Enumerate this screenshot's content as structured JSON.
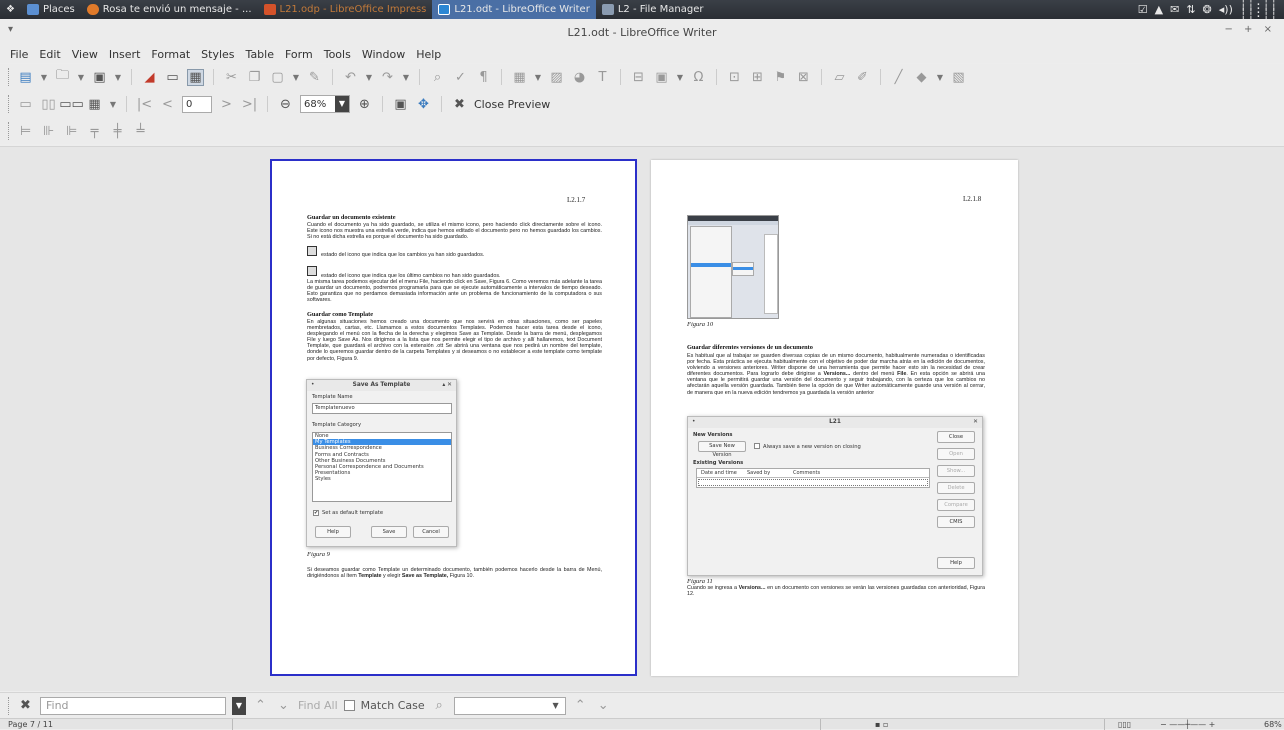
{
  "panel": {
    "places": "Places",
    "tasks": [
      {
        "label": "Rosa te envió un mensaje - ...",
        "style": "normal",
        "icon_color": "#e07a2a"
      },
      {
        "label": "L21.odp - LibreOffice Impress",
        "style": "dim",
        "icon_color": "#d4522a"
      },
      {
        "label": "L21.odt - LibreOffice Writer",
        "style": "active",
        "icon_color": "#2a86d4"
      },
      {
        "label": "L2 - File Manager",
        "style": "normal",
        "icon_color": "#8a9bb0"
      }
    ],
    "tray_icons": [
      "☑",
      "▲",
      "✉",
      "⇅",
      "❂",
      "◂))"
    ]
  },
  "window": {
    "title": "L21.odt - LibreOffice Writer",
    "left_glyph": "▾",
    "right_glyphs": "− + ×"
  },
  "menu": [
    "File",
    "Edit",
    "View",
    "Insert",
    "Format",
    "Styles",
    "Table",
    "Form",
    "Tools",
    "Window",
    "Help"
  ],
  "preview_toolbar": {
    "page_value": "0",
    "zoom_value": "68%",
    "close_preview": "Close Preview"
  },
  "page1": {
    "number": "L2.1.7",
    "heading1": "Guardar un documento existente",
    "para1": "Cuando el documento ya ha sido guardado, se utiliza el mismo icono, pero haciendo click directamente sobre el icono. Este icono nos muestra una estrella verde, indica que hemos editado el documento pero no hemos guardado los cambios. Si no está dicha estrella es porque el documento ha sido guardado.",
    "icon_line1": "estado del icono que indica que los cambios ya han sido guardados.",
    "icon_line2": "estado del icono que indica que los último cambios no han sido guardados.",
    "para2": "La misma tarea podemos ejecutar del el menu File, haciendo click en Save, Figura 6. Como veremos más adelante la tarea de guardar un documento, podremos programarla para que se ejecute automáticamente a intervalos de tiempo deseado. Esto garantiza que no perdamos demasiada información ante un problema de funcionamiento de la computadora o sus softwares.",
    "heading2": "Guardar como Template",
    "para3": "En algunas situaciones hemos creado una documento que nos servirá en otras situaciones, como ser papeles membretados, cartas, etc. Llamamos a estos documentos Templates. Podemos hacer esta tarea desde el icono, desplegando el menú con la flecha de la derecha y elegimos Save as Template. Desde la barra de menú, desplegamos File y luego Save As. Nos dirigimos a la lista que nos permite elegir el tipo de archivo y allí hallaremos, text Document Template, que guardará el archivo con la extensión .ott Se abrirá una ventana que nos pedirá un nombre del template, donde lo queremos guardar dentro de la carpeta Templates y si deseamos o no establecer a este template como template por defecto, Figura 9.",
    "dialog": {
      "title": "Save As Template",
      "name_label": "Template Name",
      "name_value": "Templatenuevo",
      "category_label": "Template Category",
      "categories": [
        "None",
        "My Templates",
        "Business Correspondence",
        "Forms and Contracts",
        "Other Business Documents",
        "Personal Correspondence and Documents",
        "Presentations",
        "Styles"
      ],
      "selected_index": 1,
      "default_checkbox": "Set as default template",
      "help": "Help",
      "save": "Save",
      "cancel": "Cancel"
    },
    "caption": "Figura 9",
    "para4_a": "Si deseamos guardar como Template un determinado documento, también podemos hacerlo desde la barra de Menú, dirigiéndonos al ítem",
    "para4_b": "Template",
    "para4_c": " y elegir ",
    "para4_d": "Save as Template,",
    "para4_e": " Figura 10."
  },
  "page2": {
    "number": "L2.1.8",
    "caption10": "Figura 10",
    "heading": "Guardar diferentes versiones de un documento",
    "para1_a": "Es habitual que al trabajar se guarden diversas copias de un mismo documento, habitualmente numeradas o identificadas por fecha. Esta práctica se ejecuta habitualmente con el objetivo de poder dar marcha atrás en la edición de documentos, volviendo a versiones anteriores. Writer dispone de una herramienta que permite hacer esto sin la necesidad de crear diferentes documentos. Para lograrlo debe dirigirse a ",
    "para1_b": "Versions...",
    "para1_c": " dentro del menú ",
    "para1_d": "File",
    "para1_e": ". En esta opción se abrirá una ventana que le permitirá guardar una versión del documento y seguir trabajando, con la certeza que los cambios no afectarán aquella versión guardada. También tiene la opción de que Writer automáticamente guarde una versión al cerrar, de manera que en la nueva edición tendremos ya guardada la versión anterior",
    "versions_dialog": {
      "title": "L21",
      "new_versions": "New Versions",
      "save_new": "Save New Version",
      "always_save": "Always save a new version on closing",
      "existing": "Existing Versions",
      "cols": [
        "Date and time",
        "Saved by",
        "Comments"
      ],
      "buttons": [
        "Close",
        "Open",
        "Show...",
        "Delete",
        "Compare",
        "CMIS"
      ],
      "help": "Help"
    },
    "caption11": "Figura 11",
    "para2_a": "Cuando se ingresa a ",
    "para2_b": "Versions...",
    "para2_c": " en un documento con versiones se verán las versiones guardadas con anterioridad, Figura 12."
  },
  "findbar": {
    "placeholder": "Find",
    "find_all": "Find All",
    "match_case": "Match Case"
  },
  "status": {
    "page": "Page 7 / 11",
    "zoom": "68%"
  }
}
